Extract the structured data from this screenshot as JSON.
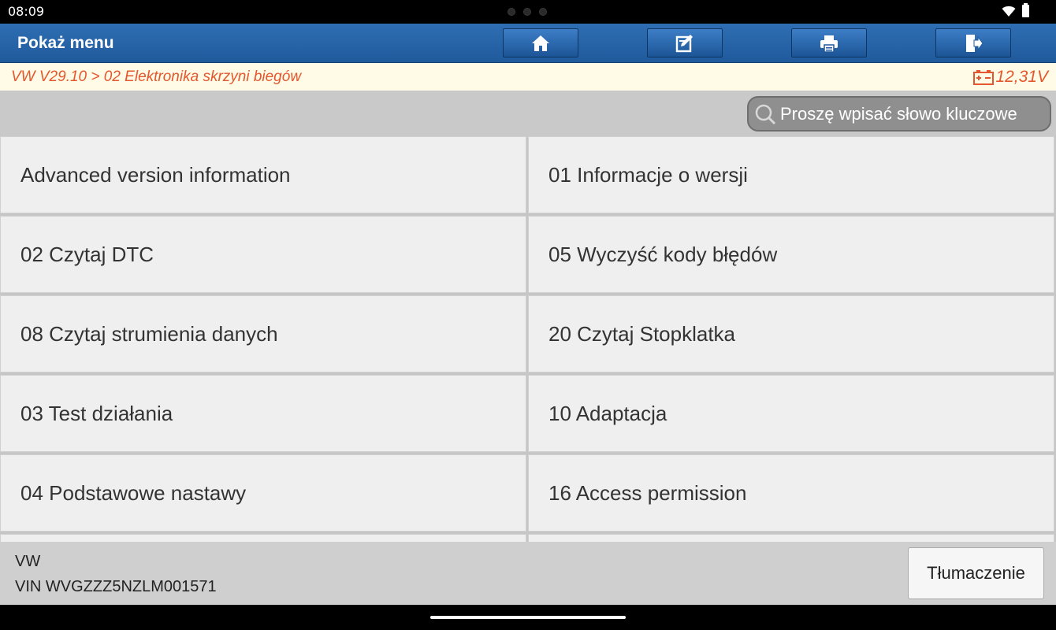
{
  "status": {
    "time": "08:09"
  },
  "header": {
    "title": "Pokaż menu"
  },
  "toolbar": [
    {
      "name": "home-button",
      "icon": "home-icon"
    },
    {
      "name": "edit-button",
      "icon": "edit-icon"
    },
    {
      "name": "print-button",
      "icon": "print-icon"
    },
    {
      "name": "exit-button",
      "icon": "exit-icon"
    }
  ],
  "breadcrumb": {
    "path": "VW V29.10 > 02 Elektronika skrzyni biegów",
    "voltage": "12,31V"
  },
  "search": {
    "placeholder": "Proszę wpisać słowo kluczowe"
  },
  "menu": {
    "items": [
      "Advanced version information",
      "01 Informacje o wersji",
      "02 Czytaj DTC",
      "05 Wyczyść kody błędów",
      "08 Czytaj strumienia danych",
      "20 Czytaj Stopklatka",
      "03 Test działania",
      "10 Adaptacja",
      "04 Podstawowe nastawy",
      "16 Access permission"
    ]
  },
  "footer": {
    "make": "VW",
    "vin": "VIN WVGZZZ5NZLM001571",
    "translate_label": "Tłumaczenie"
  },
  "colors": {
    "header_blue": "#2f6eb3",
    "crumb_text": "#e4572e",
    "crumb_bg": "#fffbe6"
  }
}
